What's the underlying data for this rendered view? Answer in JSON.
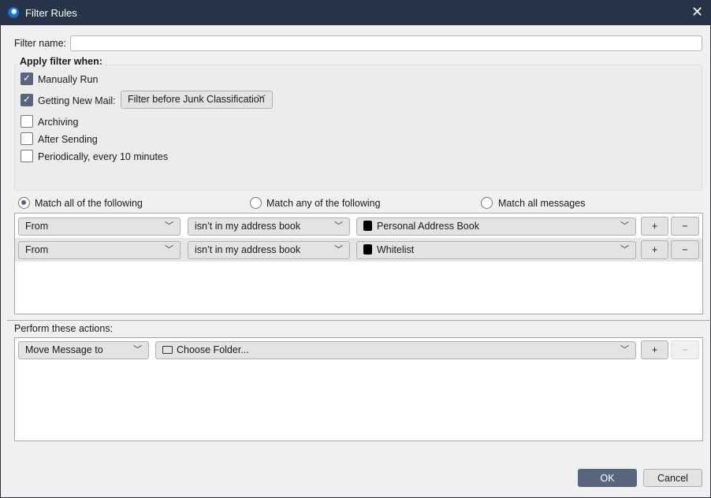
{
  "window": {
    "title": "Filter Rules",
    "close": "✕"
  },
  "filter_name": {
    "label": "Filter name:",
    "value": ""
  },
  "apply": {
    "heading": "Apply filter when:",
    "options": [
      {
        "label": "Manually Run",
        "checked": true
      },
      {
        "label": "Getting New Mail:",
        "checked": true
      },
      {
        "label": "Archiving",
        "checked": false
      },
      {
        "label": "After Sending",
        "checked": false
      },
      {
        "label": "Periodically, every 10 minutes",
        "checked": false
      }
    ],
    "junk_select": "Filter before Junk Classification"
  },
  "match": {
    "options": [
      "Match all of the following",
      "Match any of the following",
      "Match all messages"
    ],
    "selected": 0
  },
  "conditions": [
    {
      "field": "From",
      "operator": "isn’t in my address book",
      "value": "Personal Address Book"
    },
    {
      "field": "From",
      "operator": "isn’t in my address book",
      "value": "Whitelist"
    }
  ],
  "actions": {
    "heading": "Perform these actions:",
    "rows": [
      {
        "action": "Move Message to",
        "target": "Choose Folder..."
      }
    ]
  },
  "buttons": {
    "add": "+",
    "remove": "−",
    "ok": "OK",
    "cancel": "Cancel"
  },
  "chevron": "﹀"
}
